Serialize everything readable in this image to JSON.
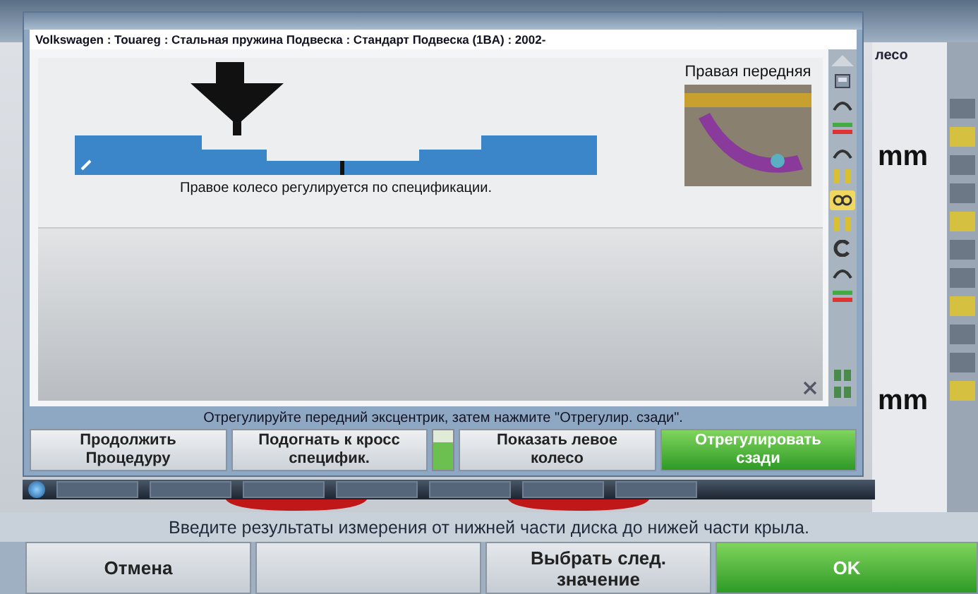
{
  "window": {
    "breadcrumb": "Volkswagen : Touareg : Стальная пружина Подвеска : Стандарт Подвеска (1BA) : 2002-"
  },
  "panel": {
    "position_label": "Правая передняя",
    "status": "Правое колесо регулируется по спецификации."
  },
  "side_tools": [
    {
      "kind": "gauge",
      "selected": false
    },
    {
      "kind": "arc",
      "selected": false
    },
    {
      "kind": "meter",
      "selected": false
    },
    {
      "kind": "arc",
      "selected": false
    },
    {
      "kind": "pair",
      "selected": false
    },
    {
      "kind": "shock",
      "selected": true
    },
    {
      "kind": "pair",
      "selected": false
    },
    {
      "kind": "wheel",
      "selected": false
    },
    {
      "kind": "arc",
      "selected": false
    },
    {
      "kind": "meter",
      "selected": false
    }
  ],
  "instruction": "Отрегулируйте передний эксцентрик, затем нажмите \"Отрегулир. сзади\".",
  "buttons": [
    {
      "kind": "normal",
      "lines": [
        "Продолжить",
        "Процедуру"
      ]
    },
    {
      "kind": "normal",
      "lines": [
        "Подогнать к кросс",
        "специфик."
      ]
    },
    {
      "kind": "indicator",
      "on": true
    },
    {
      "kind": "normal",
      "lines": [
        "Показать левое",
        "колесо"
      ]
    },
    {
      "kind": "primary",
      "lines": [
        "Отрегулировать",
        "сзади"
      ]
    }
  ],
  "background_app": {
    "header": "лесо",
    "readings": [
      "mm",
      "mm"
    ],
    "instruction": "Введите результаты измерения от нижней части диска до нижей части крыла.",
    "buttons": [
      {
        "kind": "normal",
        "lines": [
          "Отмена"
        ]
      },
      {
        "kind": "blank"
      },
      {
        "kind": "normal",
        "lines": [
          "Выбрать след.",
          "значение"
        ]
      },
      {
        "kind": "primary",
        "lines": [
          "OK"
        ]
      }
    ]
  }
}
